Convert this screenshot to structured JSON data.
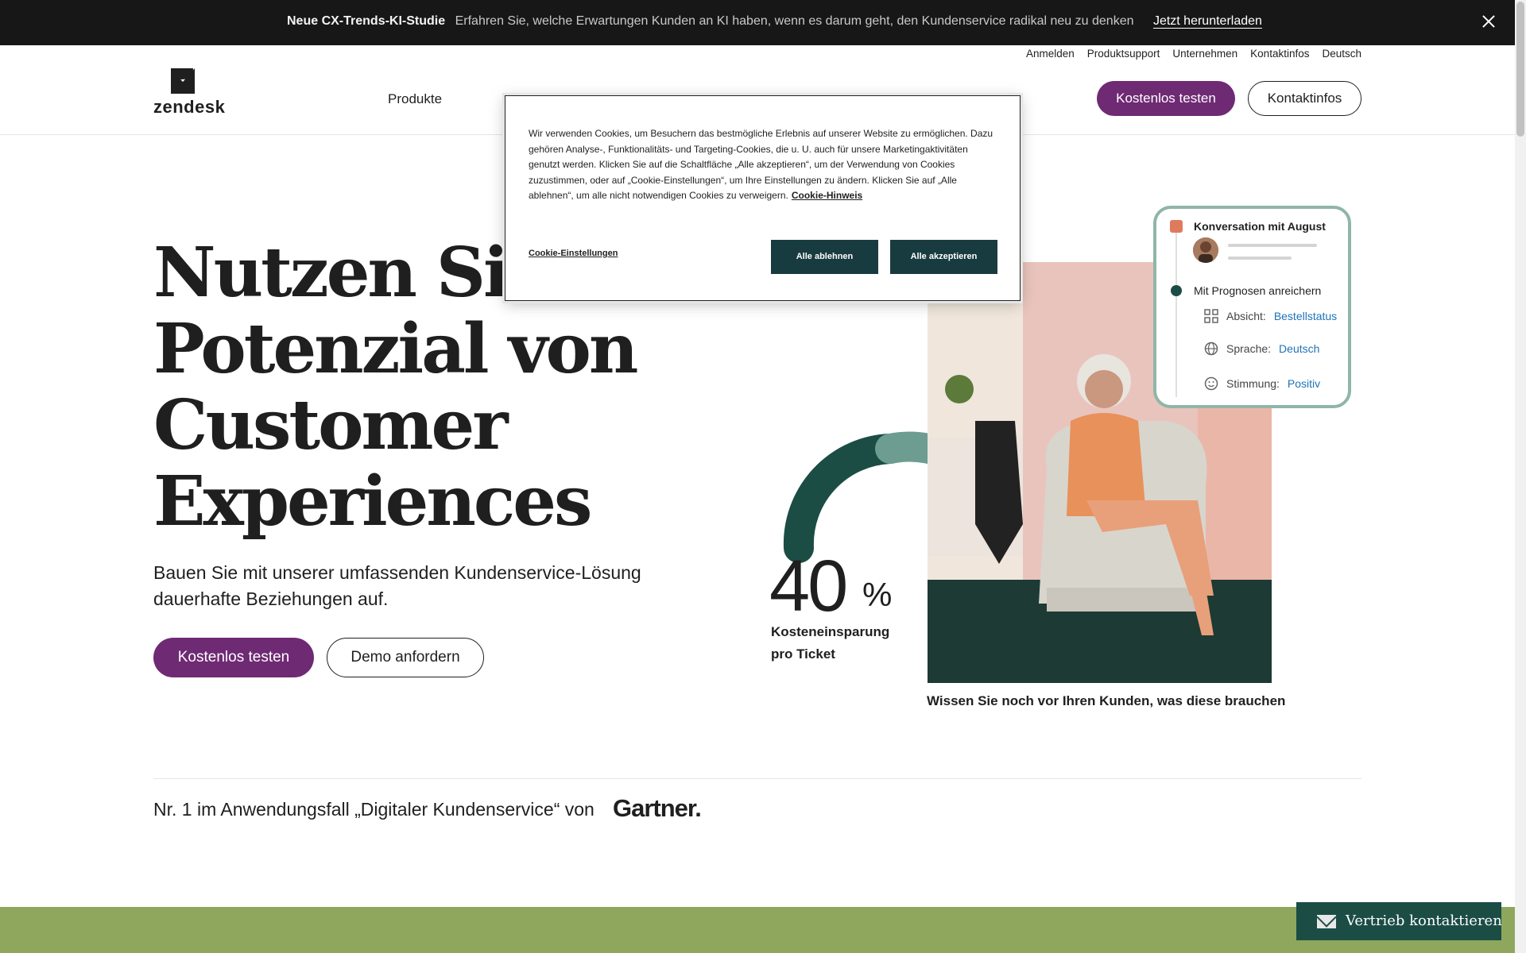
{
  "banner": {
    "title": "Neue CX-Trends-KI-Studie",
    "text": "Erfahren Sie, welche Erwartungen Kunden an KI haben, wenn es darum geht, den Kundenservice radikal neu zu denken",
    "link": "Jetzt herunterladen"
  },
  "utility_nav": [
    "Anmelden",
    "Produktsupport",
    "Unternehmen",
    "Kontaktinfos",
    "Deutsch"
  ],
  "logo_text": "zendesk",
  "main_nav": [
    "Produkte"
  ],
  "header": {
    "primary_label": "Kostenlos testen",
    "secondary_label": "Kontaktinfos"
  },
  "hero": {
    "title_line1": "Nutzen Sie das",
    "title_line2": "Potenzial von",
    "title_line3": "Customer",
    "title_line4": "Experiences",
    "subtitle": "Bauen Sie mit unserer umfassenden Kundenservice-Lösung dauerhafte Beziehungen auf.",
    "primary_label": "Kostenlos testen",
    "secondary_label": "Demo anfordern"
  },
  "stat": {
    "number": "40",
    "unit": "%",
    "label": "Kosteneinsparung pro Ticket"
  },
  "photo_caption": "Wissen Sie noch vor Ihren Kunden, was diese brauchen",
  "conversation_card": {
    "title": "Konversation mit August",
    "enrich": "Mit Prognosen anreichern",
    "rows": [
      {
        "label": "Absicht:",
        "value": "Bestellstatus",
        "icon": "grid-icon"
      },
      {
        "label": "Sprache:",
        "value": "Deutsch",
        "icon": "globe-icon"
      },
      {
        "label": "Stimmung:",
        "value": "Positiv",
        "icon": "smiley-icon"
      }
    ]
  },
  "gartner": {
    "text": "Nr. 1 im Anwendungsfall „Digitaler Kundenservice“ von",
    "logo": "Gartner."
  },
  "sales_button": "Vertrieb kontaktieren",
  "cookie": {
    "message": "Wir verwenden Cookies, um Besuchern das bestmögliche Erlebnis auf unserer Website zu ermöglichen. Dazu gehören Analyse-, Funktionalitäts- und Targeting-Cookies, die u. U. auch für unsere Marketingaktivitäten genutzt werden. Klicken Sie auf die Schaltfläche „Alle akzeptieren“, um der Verwendung von Cookies zuzustimmen, oder auf „Cookie-Einstellungen“, um Ihre Einstellungen zu ändern. Klicken Sie auf „Alle ablehnen“, um alle nicht notwendigen Cookies zu verweigern.",
    "notice_link": "Cookie-Hinweis",
    "settings": "Cookie-Einstellungen",
    "reject": "Alle ablehnen",
    "accept": "Alle akzeptieren"
  },
  "colors": {
    "brand_purple": "#6f2a74",
    "dark_green": "#1b4d45",
    "banner_bg": "#171717",
    "band_green": "#8ea75d",
    "link_blue": "#1f73b7"
  }
}
